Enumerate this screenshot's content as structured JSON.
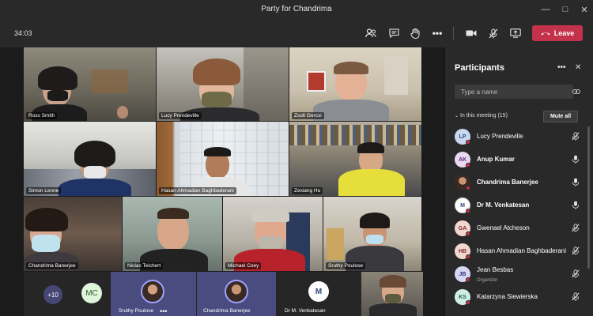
{
  "window": {
    "title": "Party for Chandrima"
  },
  "toolbar": {
    "timer": "34:03",
    "leave_label": "Leave"
  },
  "video_tiles": [
    {
      "name": "Ross Smith"
    },
    {
      "name": "Lucy Prendeville"
    },
    {
      "name": "Zsolt Gercsi"
    },
    {
      "name": "Simon Lenne"
    },
    {
      "name": "Hasan Ahmadian Baghbaderani"
    },
    {
      "name": "Zexiang Hu"
    },
    {
      "name": "Chandrima Banerjee"
    },
    {
      "name": "Niclas Teichert"
    },
    {
      "name": "Michael Coey"
    },
    {
      "name": "Sruthy Poulose"
    }
  ],
  "strip": {
    "overflow_count": "+10",
    "mc_initials": "MC",
    "tiles": [
      {
        "name": "Sruthy Poulose"
      },
      {
        "name": "Chandrima Banerjee"
      },
      {
        "name": "Dr M. Venkatesan"
      }
    ]
  },
  "panel": {
    "title": "Participants",
    "search_placeholder": "Type a name",
    "in_meeting_label": "In this meeting (15)",
    "mute_all_label": "Mute all",
    "participants": [
      {
        "initials": "LP",
        "name": "Lucy Prendeville",
        "role": "",
        "bold": false,
        "avatar_color": "#c9d8f0",
        "text_color": "#2c4a7a",
        "mic": "muted"
      },
      {
        "initials": "AK",
        "name": "Anup Kumar",
        "role": "",
        "bold": true,
        "avatar_color": "#e8d8f0",
        "text_color": "#5b2a7a",
        "mic": "on"
      },
      {
        "initials": "",
        "name": "Chandrima Banerjee",
        "role": "",
        "bold": true,
        "avatar_color": "#9ea2ff",
        "text_color": "#fff",
        "mic": "on"
      },
      {
        "initials": "M",
        "name": "Dr M. Venkatesan",
        "role": "",
        "bold": true,
        "avatar_color": "#ffffff",
        "text_color": "#2c4a7a",
        "mic": "on"
      },
      {
        "initials": "GA",
        "name": "Gwenael Atcheson",
        "role": "",
        "bold": false,
        "avatar_color": "#f3d6d0",
        "text_color": "#7a2c2c",
        "mic": "muted"
      },
      {
        "initials": "HB",
        "name": "Hasan Ahmadian Baghbaderani",
        "role": "",
        "bold": false,
        "avatar_color": "#f3d6d0",
        "text_color": "#7a2c2c",
        "mic": "muted"
      },
      {
        "initials": "JB",
        "name": "Jean Besbas",
        "role": "Organizer",
        "bold": false,
        "avatar_color": "#d6d8f3",
        "text_color": "#2c2f7a",
        "mic": "muted"
      },
      {
        "initials": "KS",
        "name": "Katarzyna Siewierska",
        "role": "",
        "bold": false,
        "avatar_color": "#d0efe6",
        "text_color": "#1f5e4c",
        "mic": "muted"
      }
    ]
  },
  "colors": {
    "leave": "#c4314b",
    "accent": "#9ea2ff",
    "panel": "#292929",
    "titlebar": "#292929"
  }
}
